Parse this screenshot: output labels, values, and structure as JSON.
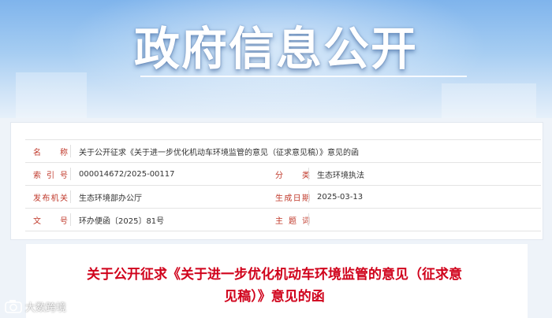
{
  "banner": {
    "title": "政府信息公开"
  },
  "metadata": {
    "name_label": "名 称",
    "name_value": "关于公开征求《关于进一步优化机动车环境监管的意见（征求意见稿）》意见的函",
    "index_label": "索 引 号",
    "index_value": "000014672/2025-00117",
    "category_label": "分 类",
    "category_value": "生态环境执法",
    "issuer_label": "发布机关",
    "issuer_value": "生态环境部办公厅",
    "date_label": "生成日期",
    "date_value": "2025-03-13",
    "docno_label": "文 号",
    "docno_value": "环办便函〔2025〕81号",
    "subject_label": "主 题 词",
    "subject_value": ""
  },
  "document": {
    "title": "关于公开征求《关于进一步优化机动车环境监管的意见（征求意见稿）》意见的函"
  },
  "watermark": {
    "text": "大数跨境",
    "icon": "camera-logo-icon"
  },
  "colors": {
    "label_red": "#c0392b",
    "title_red": "#d0021b",
    "banner_blue": "#7fb4ec"
  }
}
